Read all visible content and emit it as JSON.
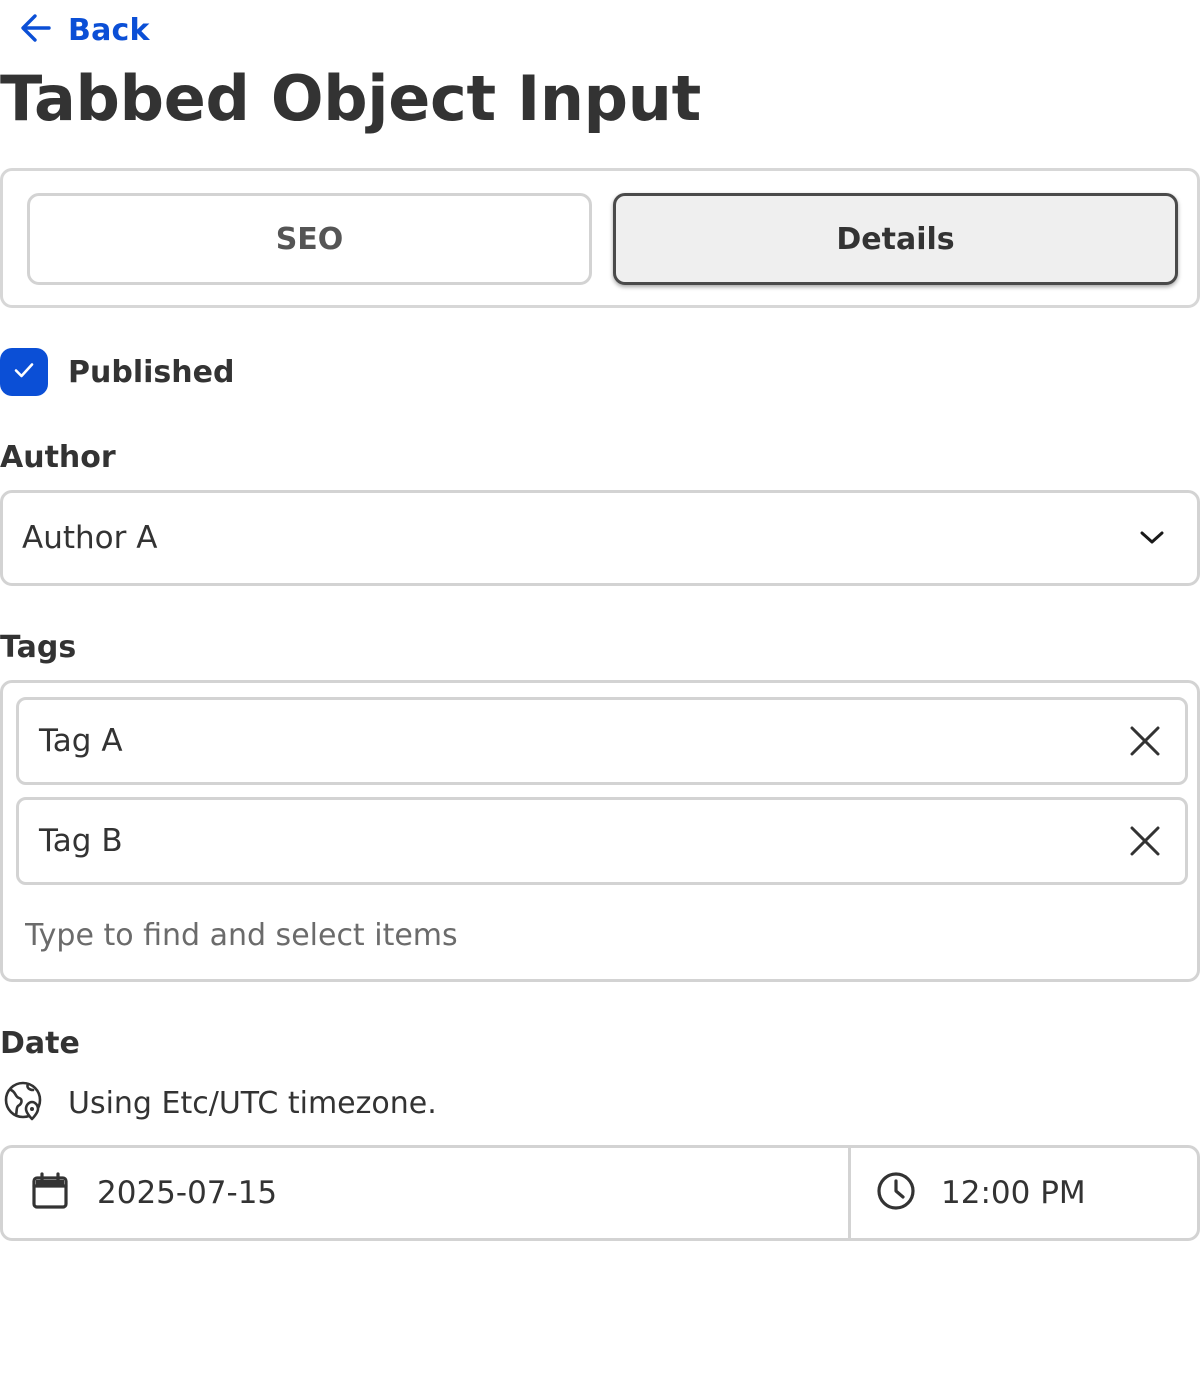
{
  "nav": {
    "back_label": "Back"
  },
  "page": {
    "title": "Tabbed Object Input"
  },
  "tabs": [
    {
      "label": "SEO",
      "selected": false
    },
    {
      "label": "Details",
      "selected": true
    }
  ],
  "published": {
    "label": "Published",
    "checked": true
  },
  "author": {
    "label": "Author",
    "value": "Author A"
  },
  "tags": {
    "label": "Tags",
    "items": [
      "Tag A",
      "Tag B"
    ],
    "placeholder": "Type to find and select items"
  },
  "date": {
    "label": "Date",
    "timezone_note": "Using Etc/UTC timezone.",
    "date_value": "2025-07-15",
    "time_value": "12:00 PM"
  },
  "icons": {
    "back": "arrow-left-icon",
    "checkbox": "checkmark-icon",
    "author_select": "chevron-down-icon",
    "tag_remove": "close-icon",
    "timezone": "globe-location-icon",
    "date": "calendar-icon",
    "time": "clock-icon"
  },
  "colors": {
    "accent": "#0b4fd6",
    "text": "#333333",
    "border": "#d3d3d3",
    "selected_tab_bg": "#efefef"
  }
}
